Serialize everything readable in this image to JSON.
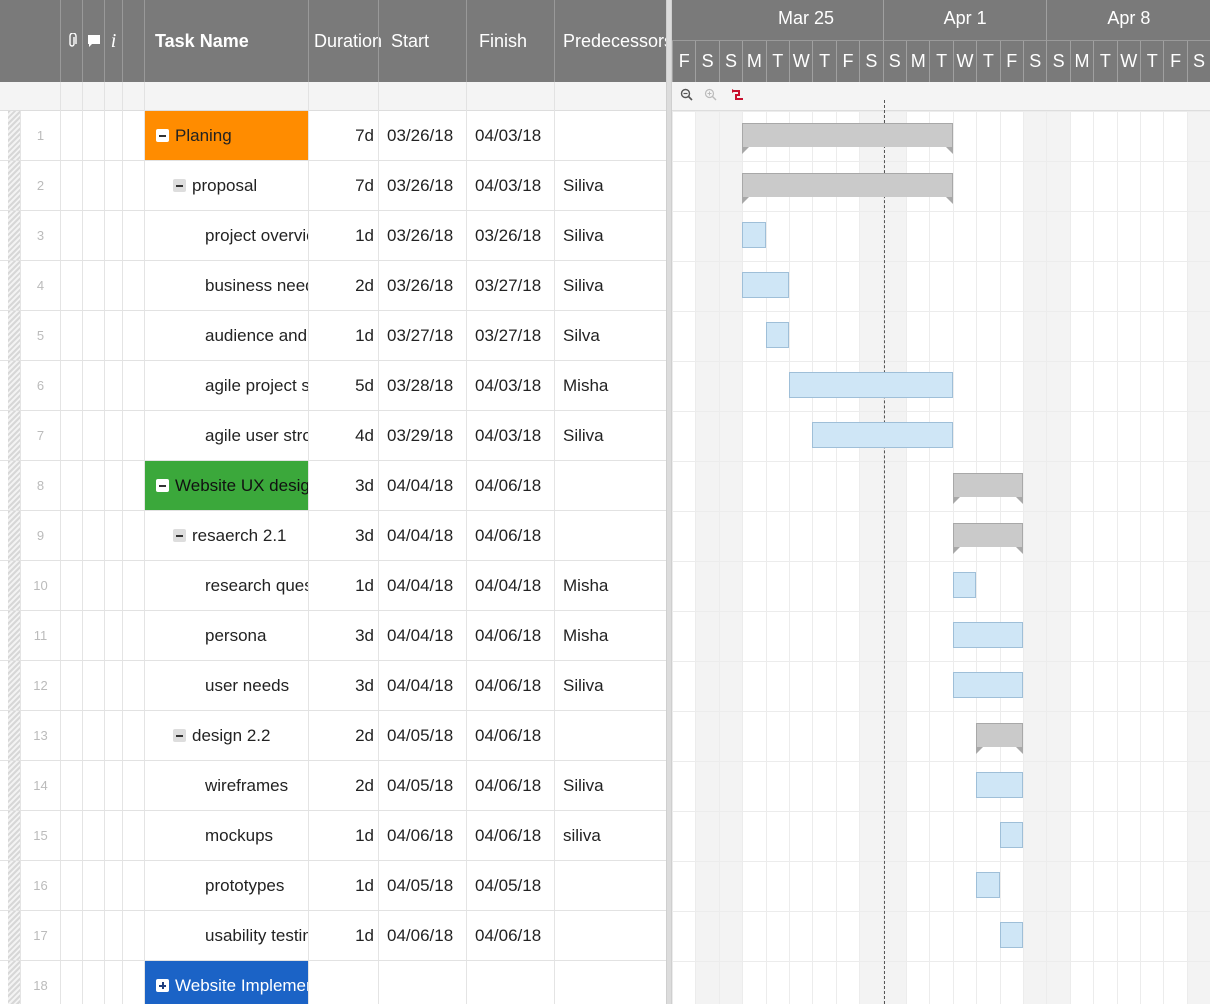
{
  "grid": {
    "headers": {
      "task_name": "Task Name",
      "duration": "Duration",
      "start": "Start",
      "finish": "Finish",
      "predecessors": "Predecessors"
    },
    "header_icons": [
      "paperclip-icon",
      "comment-icon",
      "info-icon"
    ],
    "rows": [
      {
        "num": "1",
        "name": "Planing",
        "level": 0,
        "toggle": "minus",
        "highlight": "#ff8c00",
        "duration": "7d",
        "start": "03/26/18",
        "finish": "04/03/18",
        "pred": ""
      },
      {
        "num": "2",
        "name": "proposal",
        "level": 1,
        "toggle": "minus",
        "highlight": "",
        "duration": "7d",
        "start": "03/26/18",
        "finish": "04/03/18",
        "pred": "Siliva"
      },
      {
        "num": "3",
        "name": "project overvie",
        "level": 2,
        "toggle": "",
        "highlight": "",
        "duration": "1d",
        "start": "03/26/18",
        "finish": "03/26/18",
        "pred": "Siliva"
      },
      {
        "num": "4",
        "name": "business need",
        "level": 2,
        "toggle": "",
        "highlight": "",
        "duration": "2d",
        "start": "03/26/18",
        "finish": "03/27/18",
        "pred": "Siliva"
      },
      {
        "num": "5",
        "name": "audience and s",
        "level": 2,
        "toggle": "",
        "highlight": "",
        "duration": "1d",
        "start": "03/27/18",
        "finish": "03/27/18",
        "pred": "Silva"
      },
      {
        "num": "6",
        "name": "agile project sc",
        "level": 2,
        "toggle": "",
        "highlight": "",
        "duration": "5d",
        "start": "03/28/18",
        "finish": "04/03/18",
        "pred": "Misha"
      },
      {
        "num": "7",
        "name": "agile user stroy",
        "level": 2,
        "toggle": "",
        "highlight": "",
        "duration": "4d",
        "start": "03/29/18",
        "finish": "04/03/18",
        "pred": "Siliva"
      },
      {
        "num": "8",
        "name": "Website UX design",
        "level": 0,
        "toggle": "minus",
        "highlight": "#3ba83b",
        "duration": "3d",
        "start": "04/04/18",
        "finish": "04/06/18",
        "pred": ""
      },
      {
        "num": "9",
        "name": "resaerch 2.1",
        "level": 1,
        "toggle": "minus",
        "highlight": "",
        "duration": "3d",
        "start": "04/04/18",
        "finish": "04/06/18",
        "pred": ""
      },
      {
        "num": "10",
        "name": "research quest",
        "level": 2,
        "toggle": "",
        "highlight": "",
        "duration": "1d",
        "start": "04/04/18",
        "finish": "04/04/18",
        "pred": "Misha"
      },
      {
        "num": "11",
        "name": "persona",
        "level": 2,
        "toggle": "",
        "highlight": "",
        "duration": "3d",
        "start": "04/04/18",
        "finish": "04/06/18",
        "pred": "Misha"
      },
      {
        "num": "12",
        "name": "user needs",
        "level": 2,
        "toggle": "",
        "highlight": "",
        "duration": "3d",
        "start": "04/04/18",
        "finish": "04/06/18",
        "pred": "Siliva"
      },
      {
        "num": "13",
        "name": "design 2.2",
        "level": 1,
        "toggle": "minus",
        "highlight": "",
        "duration": "2d",
        "start": "04/05/18",
        "finish": "04/06/18",
        "pred": ""
      },
      {
        "num": "14",
        "name": "wireframes",
        "level": 2,
        "toggle": "",
        "highlight": "",
        "duration": "2d",
        "start": "04/05/18",
        "finish": "04/06/18",
        "pred": "Siliva"
      },
      {
        "num": "15",
        "name": "mockups",
        "level": 2,
        "toggle": "",
        "highlight": "",
        "duration": "1d",
        "start": "04/06/18",
        "finish": "04/06/18",
        "pred": "siliva"
      },
      {
        "num": "16",
        "name": "prototypes",
        "level": 2,
        "toggle": "",
        "highlight": "",
        "duration": "1d",
        "start": "04/05/18",
        "finish": "04/05/18",
        "pred": ""
      },
      {
        "num": "17",
        "name": "usability testing",
        "level": 2,
        "toggle": "",
        "highlight": "",
        "duration": "1d",
        "start": "04/06/18",
        "finish": "04/06/18",
        "pred": ""
      },
      {
        "num": "18",
        "name": "Website Implementa",
        "level": 0,
        "toggle": "plus",
        "highlight": "#1b63c6",
        "duration": "",
        "start": "",
        "finish": "",
        "pred": ""
      }
    ]
  },
  "gantt": {
    "months": [
      "Mar 25",
      "Apr 1",
      "Apr 8"
    ],
    "days": [
      "F",
      "S",
      "S",
      "M",
      "T",
      "W",
      "T",
      "F",
      "S",
      "S",
      "M",
      "T",
      "W",
      "T",
      "F",
      "S",
      "S",
      "M",
      "T",
      "W",
      "T",
      "F",
      "S"
    ],
    "tools": [
      "zoom-out-icon",
      "zoom-in-icon",
      "critical-path-icon"
    ],
    "colors": {
      "task_bar": "#cfe6f6",
      "summary_bar": "#cacaca",
      "header": "#7a7a7a"
    }
  }
}
